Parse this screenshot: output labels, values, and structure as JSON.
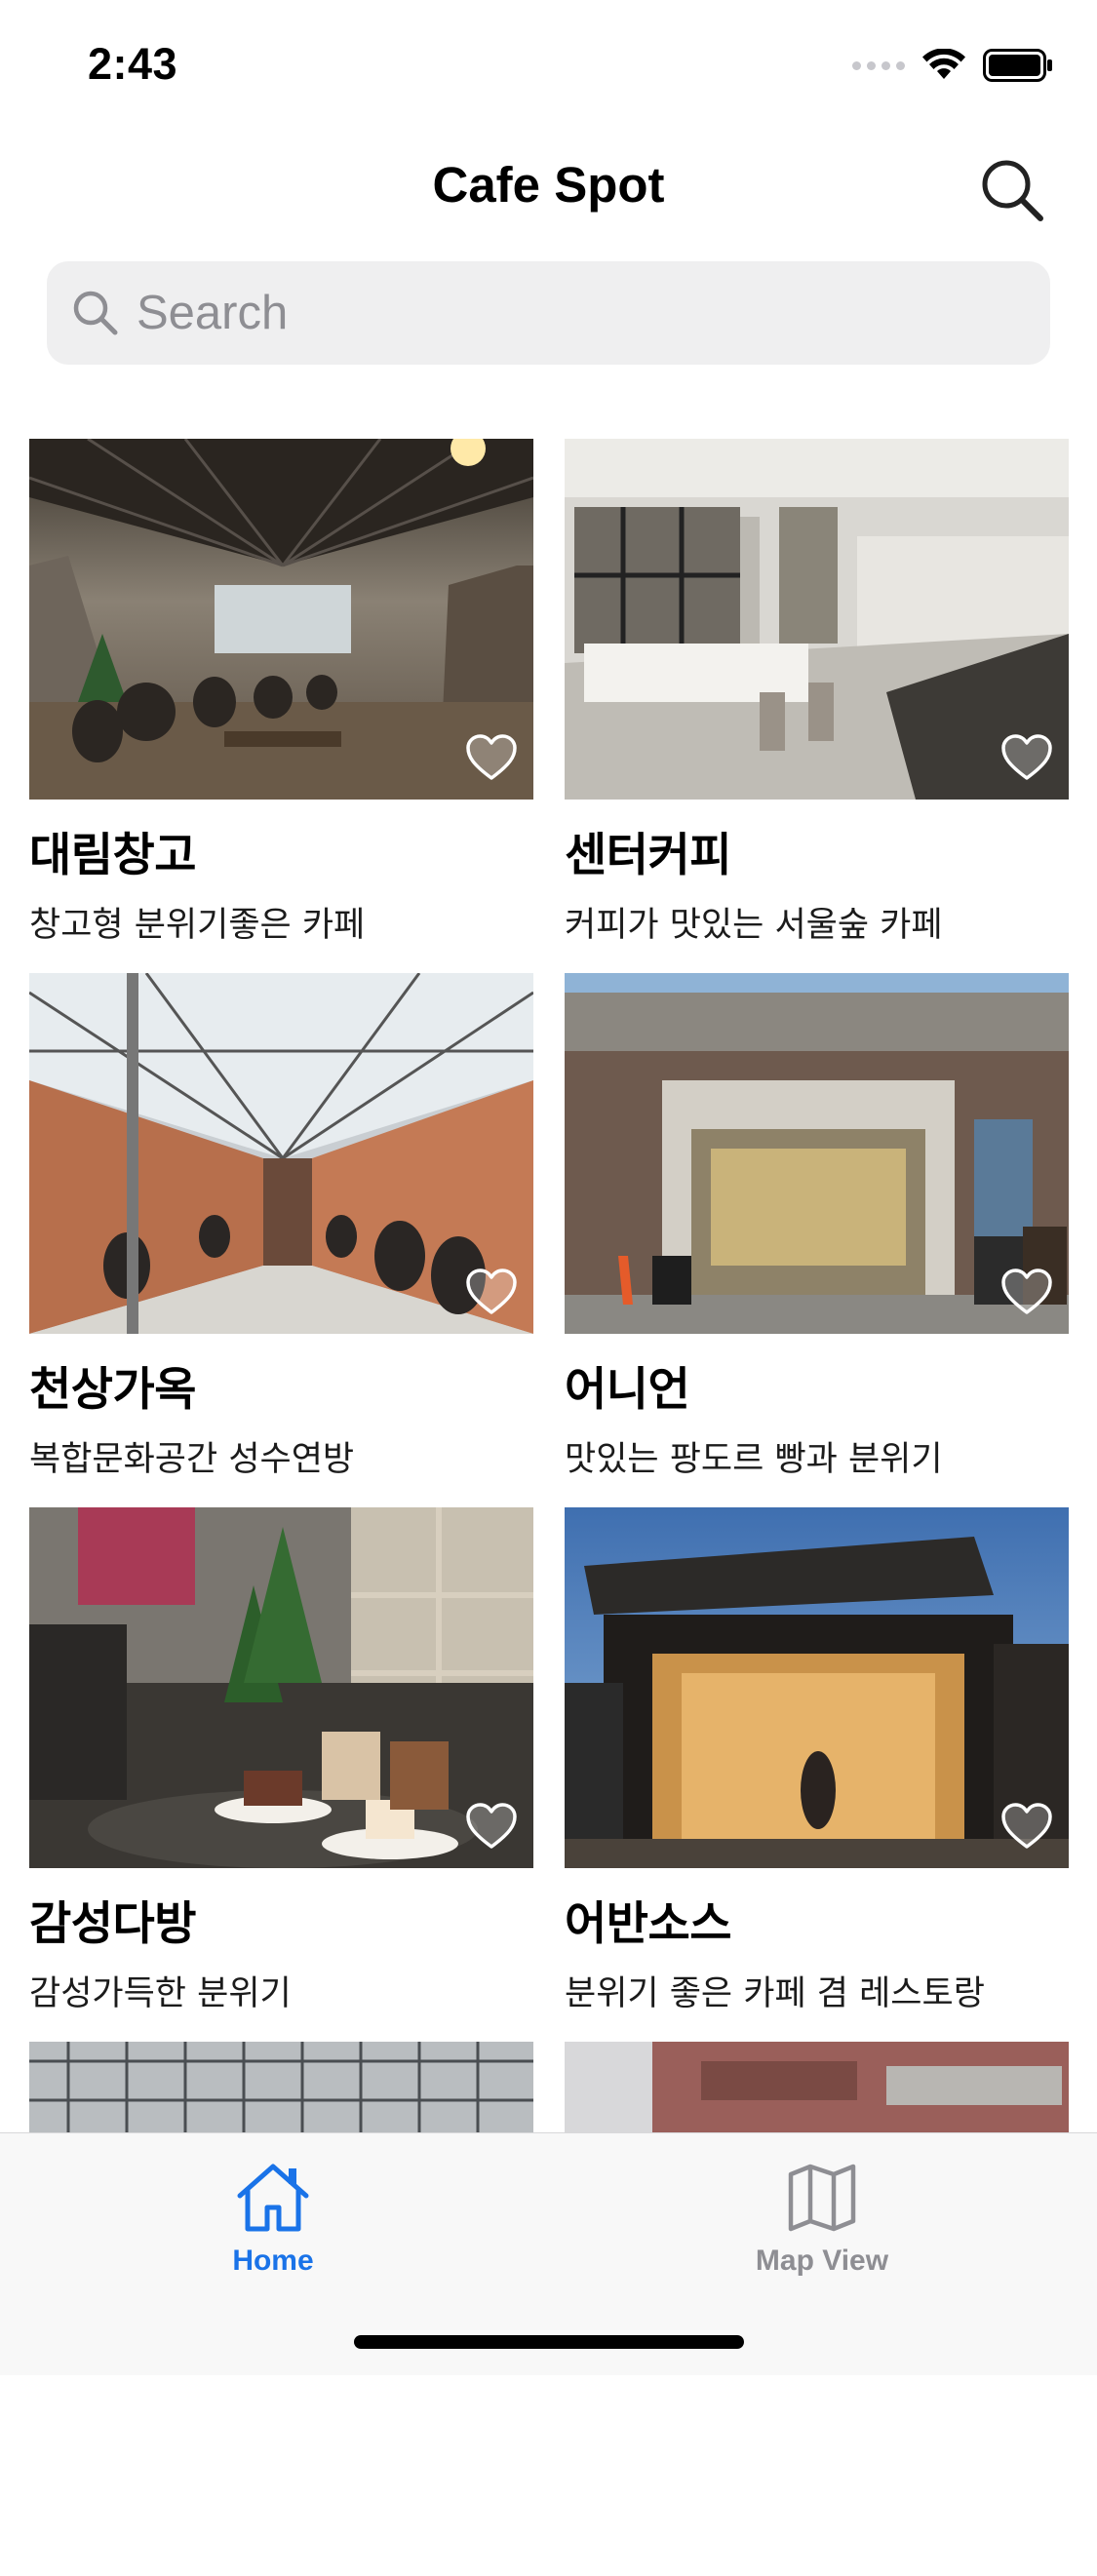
{
  "status_bar": {
    "time": "2:43",
    "icons": [
      "signal-dots-icon",
      "wifi-icon",
      "battery-icon"
    ]
  },
  "header": {
    "title": "Cafe Spot",
    "action_icon": "search-icon"
  },
  "search": {
    "placeholder": "Search",
    "value": ""
  },
  "cafes": [
    {
      "name": "대림창고",
      "description": "창고형 분위기좋은 카페",
      "photo": "warehouse-cafe-interior",
      "favorite": false
    },
    {
      "name": "센터커피",
      "description": "커피가 맛있는 서울숲 카페",
      "photo": "bright-coffee-bar-interior",
      "favorite": false
    },
    {
      "name": "천상가옥",
      "description": "복합문화공간 성수연방",
      "photo": "glass-roof-cafe-interior",
      "favorite": false
    },
    {
      "name": "어니언",
      "description": "맛있는 팡도르 빵과 분위기",
      "photo": "onion-brick-building-entrance",
      "favorite": false
    },
    {
      "name": "감성다방",
      "description": "감성가득한 분위기",
      "photo": "cake-and-drinks-table",
      "favorite": false
    },
    {
      "name": "어반소스",
      "description": "분위기 좋은 카페 겸 레스토랑",
      "photo": "urban-source-lit-storefront",
      "favorite": false
    }
  ],
  "partial_cards": [
    "building-facade-glass",
    "building-facade-brick"
  ],
  "tab_bar": {
    "tabs": [
      {
        "label": "Home",
        "icon": "home-icon",
        "selected": true
      },
      {
        "label": "Map View",
        "icon": "map-icon",
        "selected": false
      }
    ]
  },
  "colors": {
    "accent": "#1a73e8",
    "inactive": "#8e8e93",
    "search_bg": "#efeff0"
  }
}
